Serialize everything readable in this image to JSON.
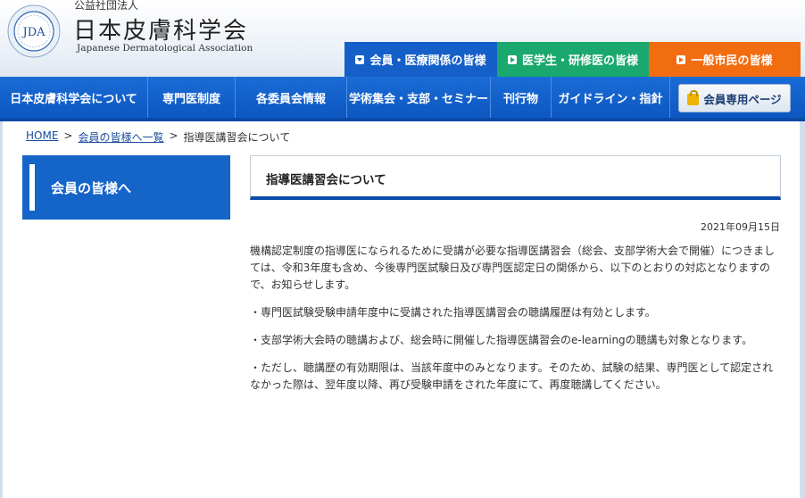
{
  "header": {
    "logo_text": "JDA",
    "org_type": "公益社団法人",
    "org_name": "日本皮膚科学会",
    "org_name_en": "Japanese Dermatological Association"
  },
  "audience_tabs": [
    {
      "label": "会員・医療関係の皆様",
      "color": "#1560c8"
    },
    {
      "label": "医学生・研修医の皆様",
      "color": "#1aa86e"
    },
    {
      "label": "一般市民の皆様",
      "color": "#f26c10"
    }
  ],
  "nav": {
    "items": [
      {
        "label": "日本皮膚科学会について"
      },
      {
        "label": "専門医制度"
      },
      {
        "label": "各委員会情報"
      },
      {
        "label": "学術集会・支部・セミナー"
      },
      {
        "label": "刊行物"
      },
      {
        "label": "ガイドライン・指針"
      }
    ],
    "members_button": "会員専用ページ"
  },
  "breadcrumb": {
    "home": "HOME",
    "sep": ">",
    "members": "会員の皆様へ一覧",
    "current": "指導医講習会について"
  },
  "sidebar": {
    "label": "会員の皆様へ"
  },
  "article": {
    "title": "指導医講習会について",
    "date": "2021年09月15日",
    "paragraphs": [
      "機構認定制度の指導医になられるために受講が必要な指導医講習会（総会、支部学術大会で開催）につきましては、令和3年度も含め、今後専門医試験日及び専門医認定日の関係から、以下のとおりの対応となりますので、お知らせします。",
      "・専門医試験受験申請年度中に受講された指導医講習会の聴講履歴は有効とします。",
      "・支部学術大会時の聴講および、総会時に開催した指導医講習会のe-learningの聴講も対象となります。",
      "・ただし、聴講歴の有効期限は、当該年度中のみとなります。そのため、試験の結果、専門医として認定されなかった際は、翌年度以降、再び受験申請をされた年度にて、再度聴講してください。"
    ]
  }
}
